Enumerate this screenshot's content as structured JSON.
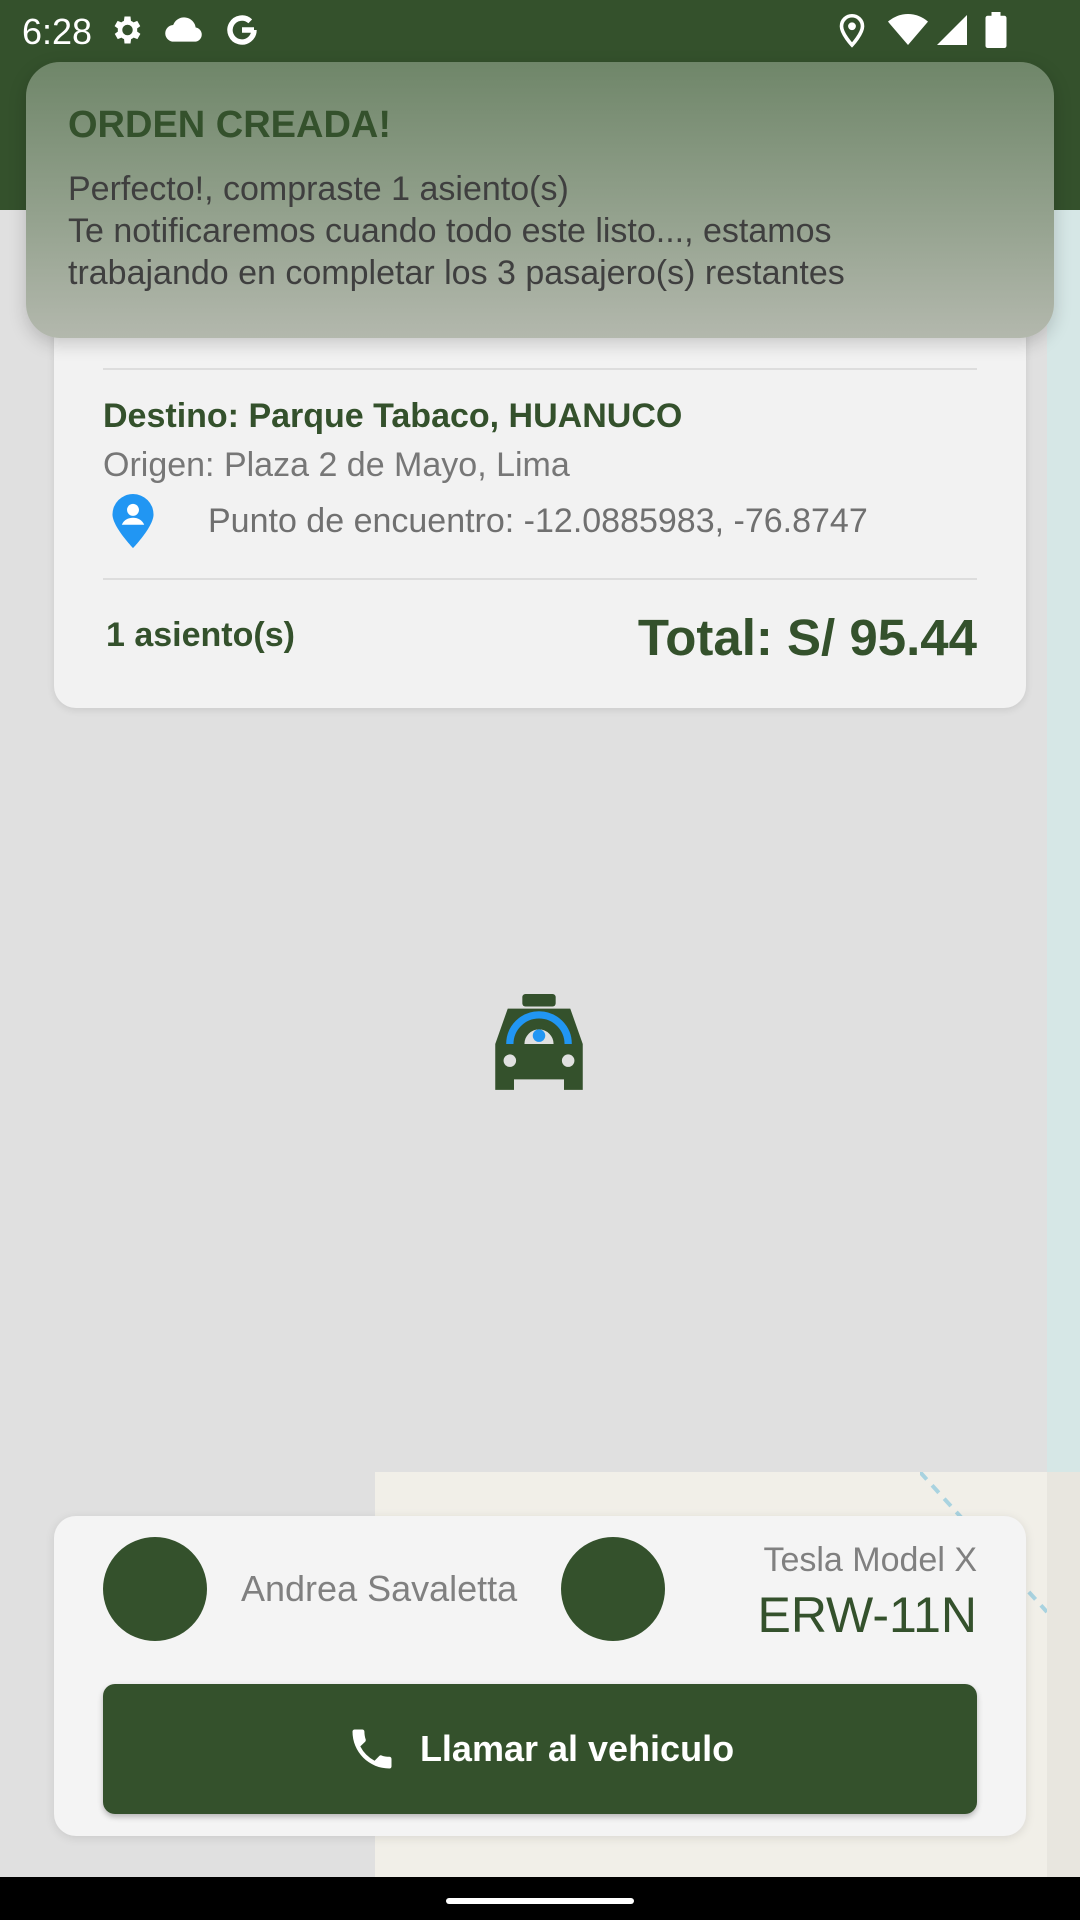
{
  "colors": {
    "primary": "#34512c",
    "pin_blue": "#2196f3",
    "toast_top": "#6f8669",
    "toast_bottom": "#b3b8ad"
  },
  "status_bar": {
    "time": "6:28",
    "left_icons": [
      "gear-icon",
      "cloud-icon",
      "google-icon"
    ],
    "right_icons": [
      "location-icon",
      "wifi-icon",
      "signal-icon",
      "battery-icon"
    ]
  },
  "toast": {
    "title": "ORDEN CREADA!",
    "line1": "Perfecto!, compraste 1 asiento(s)",
    "line2": "Te notificaremos cuando todo este listo..., estamos",
    "line3": "trabajando en completar los 3 pasajero(s) restantes"
  },
  "trip": {
    "destino": "Destino: Parque Tabaco, HUANUCO",
    "origen": "Origen: Plaza 2 de Mayo, Lima",
    "meeting_point": "Punto de encuentro: -12.0885983, -76.8747",
    "meeting_icon": "person-pin-icon",
    "seats": "1 asiento(s)",
    "total": "Total: S/ 95.44"
  },
  "map": {
    "marker_icon": "taxi-icon"
  },
  "driver": {
    "name": "Andrea Savaletta"
  },
  "vehicle": {
    "model": "Tesla Model X",
    "plate": "ERW-11N"
  },
  "actions": {
    "call_label": "Llamar al vehiculo",
    "call_icon": "phone-icon"
  }
}
